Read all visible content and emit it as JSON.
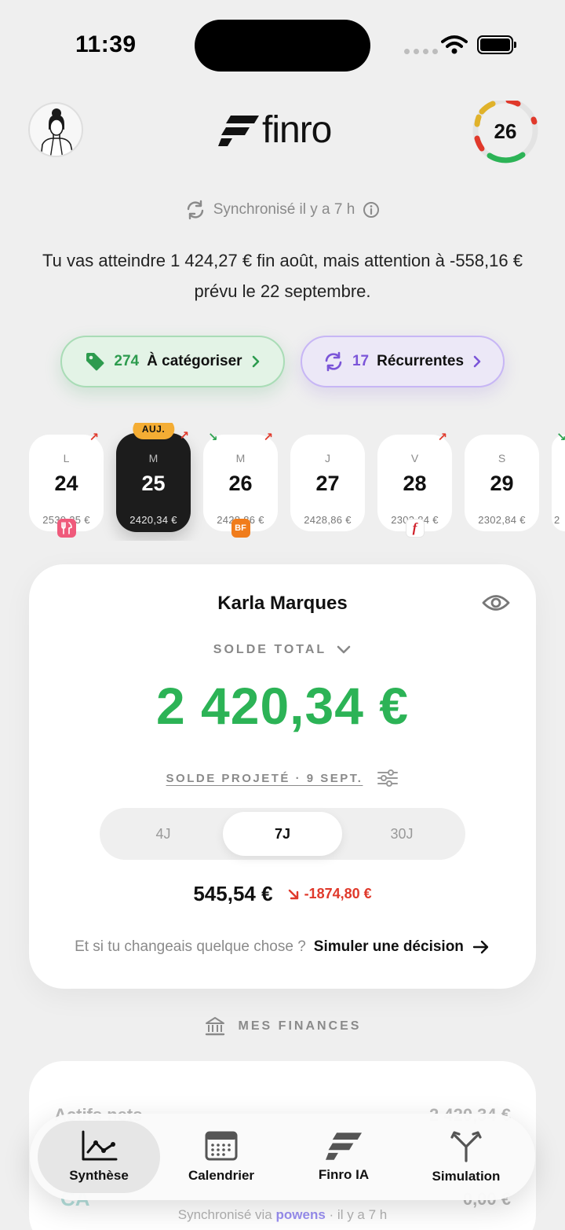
{
  "status_bar": {
    "time": "11:39"
  },
  "header": {
    "logo_text": "finro",
    "score": "26"
  },
  "sync": {
    "text": "Synchronisé il y a 7 h"
  },
  "forecast": {
    "text": "Tu vas atteindre 1 424,27 € fin août, mais attention à -558,16 € prévu le 22 septembre."
  },
  "pills": [
    {
      "count": "274",
      "label": "À catégoriser"
    },
    {
      "count": "17",
      "label": "Récurrentes"
    }
  ],
  "days": [
    {
      "weekday": "L",
      "day": "24",
      "balance": "2530,25 €",
      "arrow": "up",
      "merchant": "restaurant-icon"
    },
    {
      "weekday": "M",
      "day": "25",
      "balance": "2420,34 €",
      "arrow": "up",
      "badge": "AUJ.",
      "active": true
    },
    {
      "weekday": "M",
      "day": "26",
      "balance": "2428,86 €",
      "arrow": "down",
      "arrow2": "up",
      "merchant_text": "BF"
    },
    {
      "weekday": "J",
      "day": "27",
      "balance": "2428,86 €"
    },
    {
      "weekday": "V",
      "day": "28",
      "balance": "2302,84 €",
      "arrow": "up",
      "merchant_text": "f"
    },
    {
      "weekday": "S",
      "day": "29",
      "balance": "2302,84 €"
    },
    {
      "weekday": "",
      "day": "",
      "balance": "2",
      "arrow": "down"
    }
  ],
  "account": {
    "name": "Karla Marques",
    "total_label": "SOLDE TOTAL",
    "total_value": "2 420,34 €",
    "projected_label": "SOLDE PROJETÉ · 9 SEPT.",
    "segments": [
      "4J",
      "7J",
      "30J"
    ],
    "selected_segment": "7J",
    "projected_value": "545,54 €",
    "projected_delta": "-1874,80 €",
    "simulate_question": "Et si tu changeais quelque chose ?",
    "simulate_link": "Simuler une décision"
  },
  "finances": {
    "title": "MES FINANCES"
  },
  "finances_card": {
    "row_label": "Actifs nets",
    "row_value": "2 420,34 €",
    "bank_logo": "CA",
    "bank_balance": "0,00 €"
  },
  "footer": {
    "sync_prefix": "Synchronisé via",
    "provider": "powens",
    "sync_suffix": "· il y a 7 h"
  },
  "tabbar": [
    {
      "label": "Synthèse",
      "icon": "chart-icon",
      "active": true
    },
    {
      "label": "Calendrier",
      "icon": "calendar-icon"
    },
    {
      "label": "Finro IA",
      "icon": "finro-ai-icon"
    },
    {
      "label": "Simulation",
      "icon": "fork-icon"
    }
  ],
  "colors": {
    "positive": "#2cb356",
    "negative": "#e0392b",
    "today_badge": "#f4ad34",
    "accent_purple": "#7b55d8"
  }
}
